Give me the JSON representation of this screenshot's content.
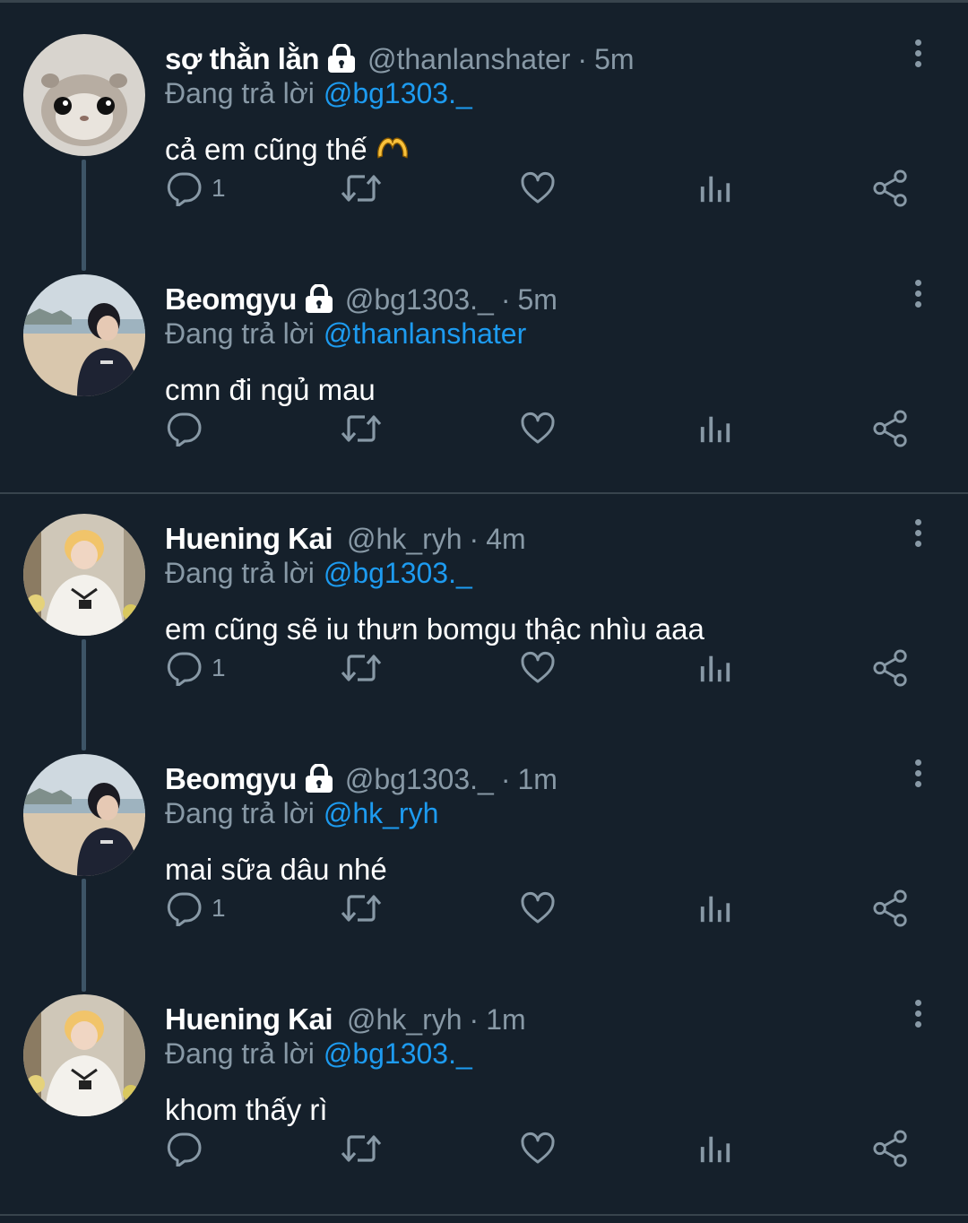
{
  "colors": {
    "background": "#15202b",
    "muted": "#8899a6",
    "link": "#1d9bf0",
    "divider": "#38444d"
  },
  "reply_prefix": "Đang trả lời",
  "tweets": [
    {
      "name": "sợ thằn lằn",
      "protected": true,
      "handle": "@thanlanshater",
      "time": "5m",
      "reply_to": "@bg1303._",
      "text": "cả em cũng thế",
      "emoji": "heart-hands",
      "reply_count": "1",
      "avatar": "hamster"
    },
    {
      "name": "Beomgyu",
      "protected": true,
      "handle": "@bg1303._",
      "time": "5m",
      "reply_to": "@thanlanshater",
      "text": "cmn đi ngủ mau",
      "reply_count": "",
      "avatar": "beach-person"
    },
    {
      "name": "Huening Kai",
      "protected": false,
      "handle": "@hk_ryh",
      "time": "4m",
      "reply_to": "@bg1303._",
      "text": "em cũng sẽ iu thưn bomgu thậc nhìu aaa",
      "reply_count": "1",
      "avatar": "blond-person"
    },
    {
      "name": "Beomgyu",
      "protected": true,
      "handle": "@bg1303._",
      "time": "1m",
      "reply_to": "@hk_ryh",
      "text": "mai sữa dâu nhé",
      "reply_count": "1",
      "avatar": "beach-person"
    },
    {
      "name": "Huening Kai",
      "protected": false,
      "handle": "@hk_ryh",
      "time": "1m",
      "reply_to": "@bg1303._",
      "text": "khom thấy rì",
      "reply_count": "",
      "avatar": "blond-person"
    }
  ]
}
